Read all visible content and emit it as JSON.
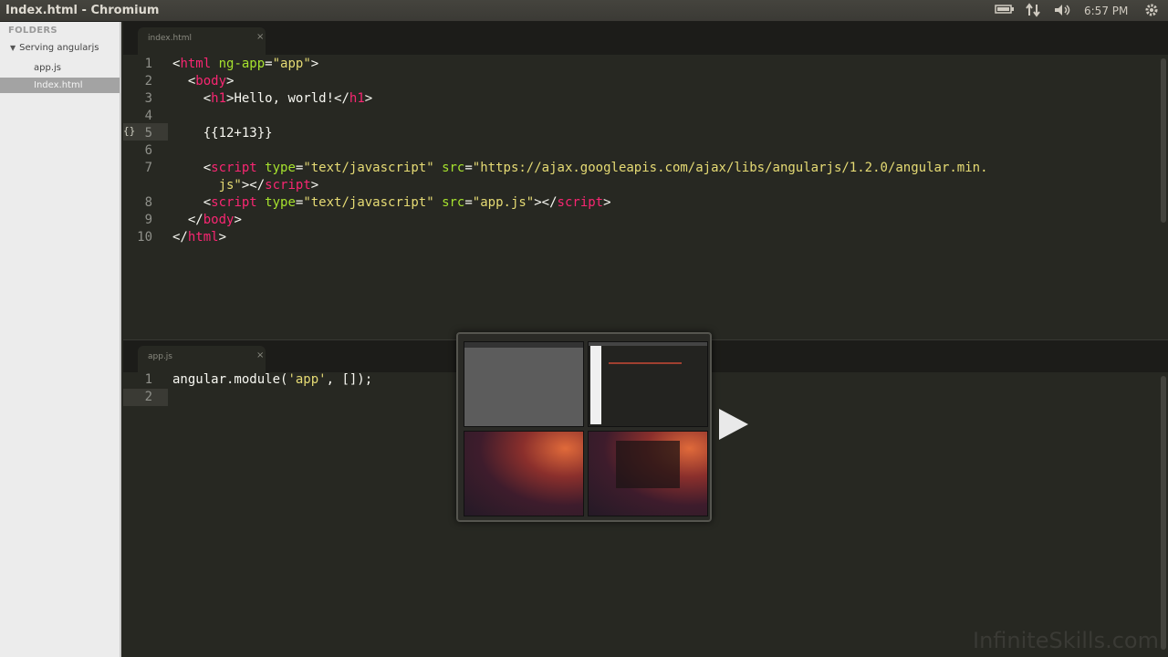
{
  "window_title": "Index.html - Chromium",
  "tray": {
    "battery_icon": "battery-icon",
    "network_icon": "network-updown-icon",
    "volume_icon": "volume-icon",
    "clock": "6:57 PM",
    "settings_icon": "gear-icon"
  },
  "sidebar": {
    "header": "FOLDERS",
    "folder": "Serving angularjs",
    "files": [
      "app.js",
      "Index.html"
    ]
  },
  "top_pane": {
    "tab_label": "index.html",
    "tab_close": "×",
    "line_numbers": [
      "1",
      "2",
      "3",
      "4",
      "5",
      "6",
      "7",
      "",
      "8",
      "9",
      "10"
    ],
    "fold_marker": "{}"
  },
  "bottom_pane": {
    "tab_label": "app.js",
    "tab_close": "×",
    "line_numbers": [
      "1",
      "2"
    ]
  },
  "watermark": "InfiniteSkills.com"
}
